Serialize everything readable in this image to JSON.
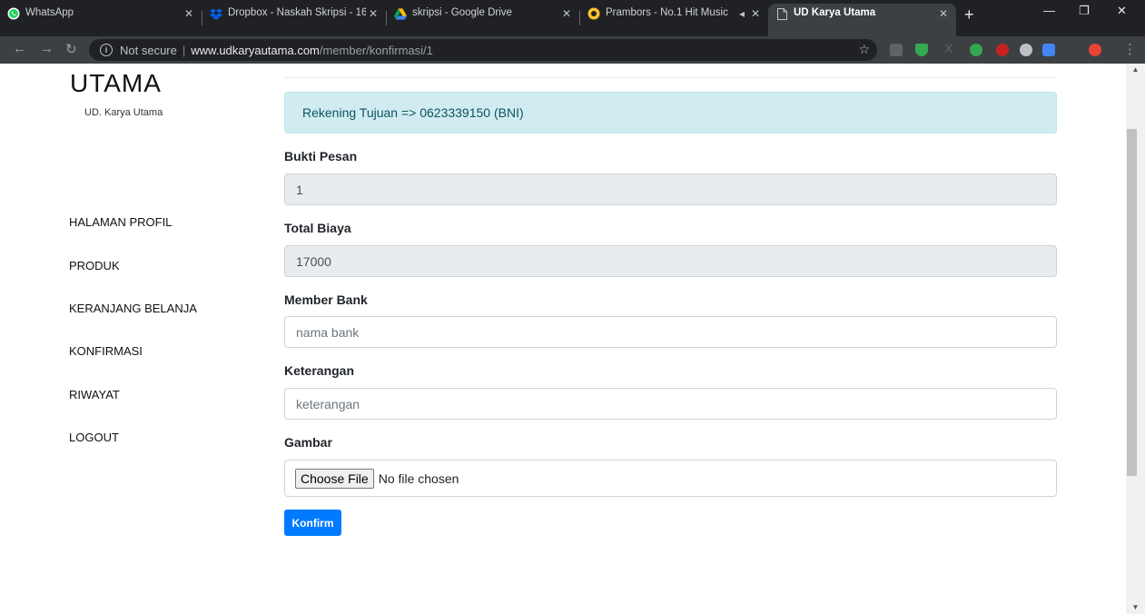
{
  "browser": {
    "tabs": [
      {
        "label": "WhatsApp",
        "active": false,
        "icon": "whatsapp-icon"
      },
      {
        "label": "Dropbox - Naskah Skripsi - 16",
        "active": false,
        "icon": "dropbox-icon"
      },
      {
        "label": "skripsi - Google Drive",
        "active": false,
        "icon": "google-drive-icon"
      },
      {
        "label": "Prambors - No.1 Hit Music",
        "active": false,
        "icon": "prambors-icon"
      },
      {
        "label": "UD Karya Utama",
        "active": true,
        "icon": "page-icon"
      }
    ],
    "address": {
      "security": "Not secure",
      "host": "www.udkaryautama.com",
      "path": "/member/konfirmasi/1"
    },
    "colors": {
      "frame": "#202124",
      "toolbar": "#3c4043"
    }
  },
  "brand": {
    "name": "UTAMA",
    "subtitle": "UD. Karya Utama"
  },
  "nav": {
    "items": [
      {
        "label": "HALAMAN PROFIL"
      },
      {
        "label": "PRODUK"
      },
      {
        "label": "KERANJANG BELANJA"
      },
      {
        "label": "KONFIRMASI"
      },
      {
        "label": "RIWAYAT"
      },
      {
        "label": "LOGOUT"
      }
    ]
  },
  "form": {
    "alert": "Rekening Tujuan => 0623339150 (BNI)",
    "fields": [
      {
        "label": "Bukti Pesan",
        "value": "1",
        "placeholder": "",
        "readonly": true
      },
      {
        "label": "Total Biaya",
        "value": "17000",
        "placeholder": "",
        "readonly": true
      },
      {
        "label": "Member Bank",
        "value": "",
        "placeholder": "nama bank",
        "readonly": false
      },
      {
        "label": "Keterangan",
        "value": "",
        "placeholder": "keterangan",
        "readonly": false
      }
    ],
    "file": {
      "label": "Gambar",
      "button": "Choose File",
      "status": "No file chosen"
    },
    "submit": "Konfirm"
  },
  "theme": {
    "primary": "#007bff",
    "alert_bg": "#d1ecf1",
    "alert_text": "#0c5460",
    "readonly_bg": "#e9ecef"
  }
}
